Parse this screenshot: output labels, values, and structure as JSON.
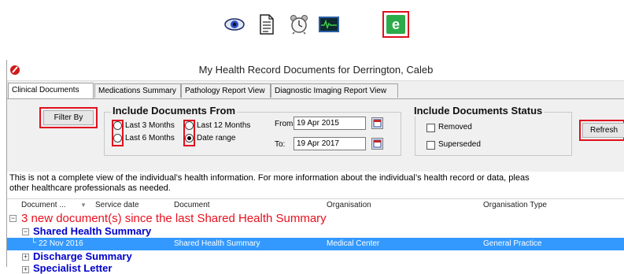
{
  "toolbar": {
    "icons": [
      "eye-icon",
      "document-icon",
      "alarm-clock-icon",
      "ecg-monitor-icon",
      "ehealth-e-icon"
    ]
  },
  "window": {
    "title": "My Health Record Documents for Derrington, Caleb"
  },
  "tabs": [
    {
      "label": "Clinical Documents",
      "active": true
    },
    {
      "label": "Medications Summary",
      "active": false
    },
    {
      "label": "Pathology Report View",
      "active": false
    },
    {
      "label": "Diagnostic Imaging Report View",
      "active": false
    }
  ],
  "filter": {
    "filter_button": "Filter By",
    "include_from_title": "Include Documents From",
    "radios": [
      {
        "label": "Last 3 Months",
        "checked": false
      },
      {
        "label": "Last 6 Months",
        "checked": false
      },
      {
        "label": "Last 12 Months",
        "checked": false
      },
      {
        "label": "Date range",
        "checked": true
      }
    ],
    "from_label": "From:",
    "from_value": "19 Apr 2015",
    "to_label": "To:",
    "to_value": "19 Apr 2017",
    "status_title": "Include Documents Status",
    "checkboxes": [
      {
        "label": "Removed",
        "checked": false
      },
      {
        "label": "Superseded",
        "checked": false
      }
    ],
    "refresh_button": "Refresh"
  },
  "notice": {
    "line1": "This is not a complete view of the individual’s health information. For more information about the individual’s health record or data, pleas",
    "line2": "other healthcare professionals as needed."
  },
  "grid": {
    "columns": [
      "Document ...",
      "Service date",
      "Document",
      "Organisation",
      "Organisation Type"
    ],
    "new_docs_heading": "3 new document(s) since the last Shared Health Summary",
    "groups": [
      {
        "label": "Shared Health Summary",
        "expanded": true
      },
      {
        "label": "Discharge Summary",
        "expanded": false
      },
      {
        "label": "Specialist Letter",
        "expanded": false
      }
    ],
    "selected_row": {
      "service_date": "22 Nov 2016",
      "document": "Shared Health Summary",
      "organisation": "Medical Center",
      "organisation_type": "General Practice"
    }
  },
  "colors": {
    "highlight_red": "#e0101e",
    "heading_red": "#e8101e",
    "group_blue": "#0000cc",
    "selection_blue": "#3399ff"
  }
}
